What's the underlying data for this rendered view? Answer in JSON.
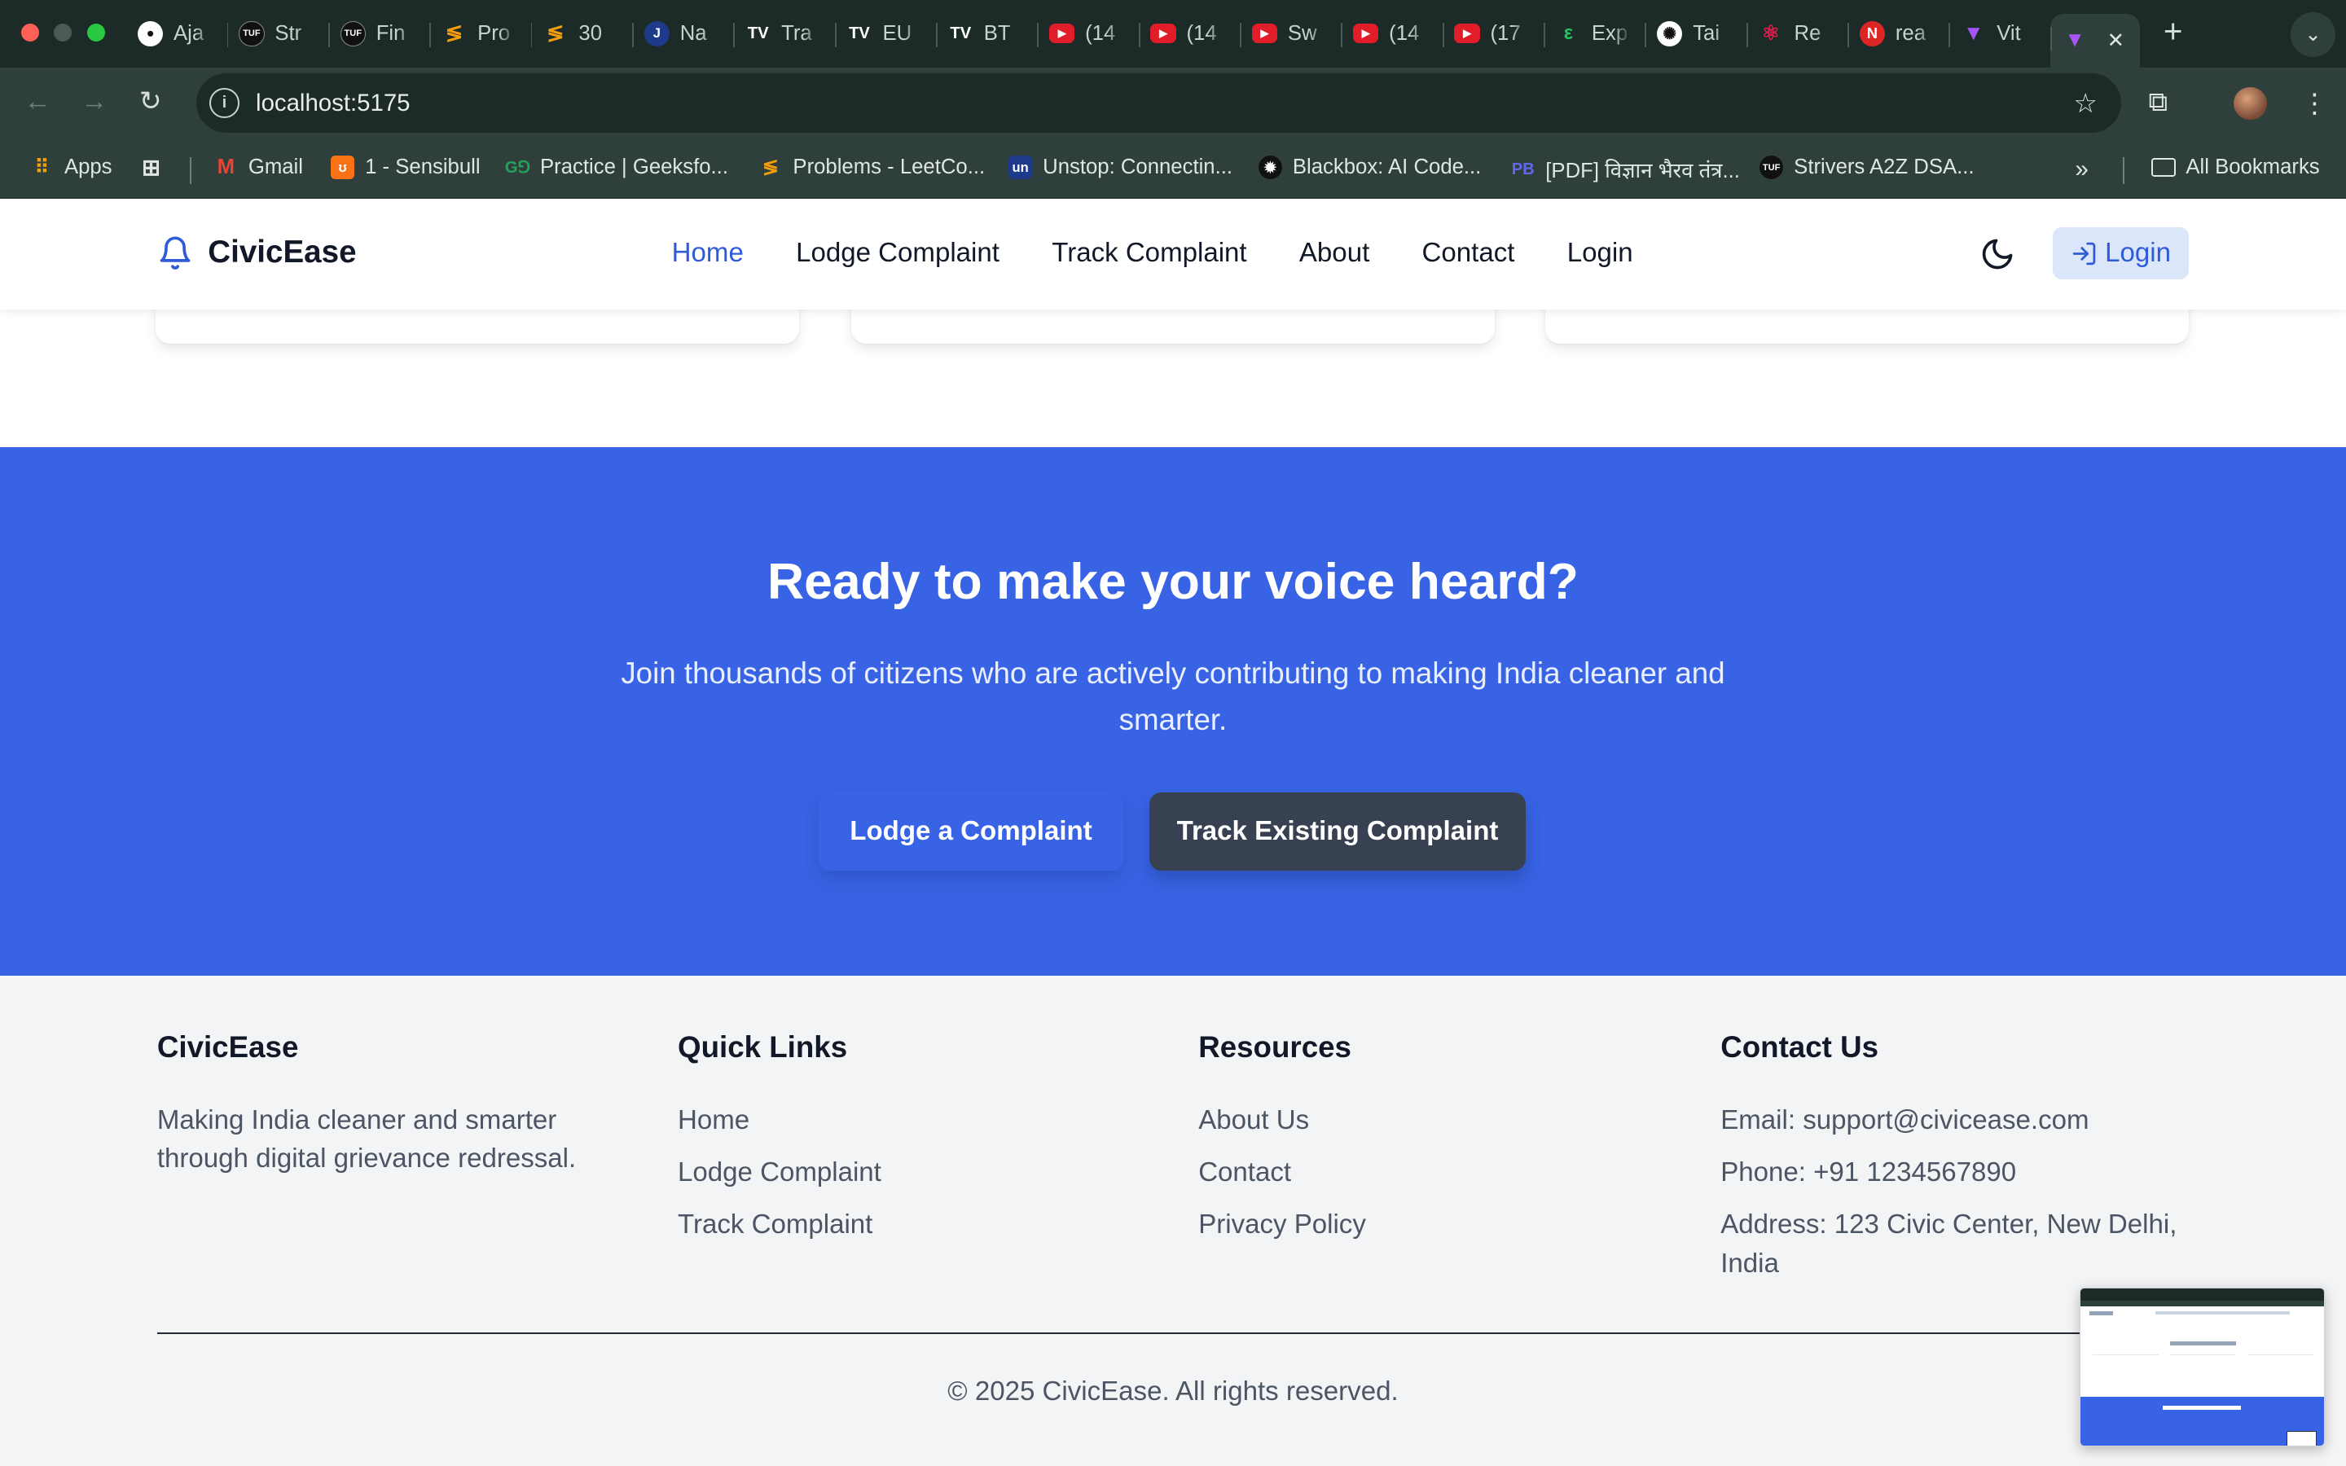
{
  "browser": {
    "tabs": [
      {
        "title": "Aja",
        "icon": "github-icon",
        "color": "#ffffff"
      },
      {
        "title": "Str",
        "icon": "tuf-icon",
        "color": "#111111"
      },
      {
        "title": "Fin",
        "icon": "tuf-icon",
        "color": "#111111"
      },
      {
        "title": "Pro",
        "icon": "codolio-icon",
        "color": "#f59e0b"
      },
      {
        "title": "30",
        "icon": "codolio-icon",
        "color": "#f59e0b"
      },
      {
        "title": "Na",
        "icon": "nav-icon",
        "color": "#1e3a8a"
      },
      {
        "title": "Tra",
        "icon": "tradingview-icon",
        "color": "#111111"
      },
      {
        "title": "EU",
        "icon": "tradingview-icon",
        "color": "#111111"
      },
      {
        "title": "BT",
        "icon": "tradingview-icon",
        "color": "#111111"
      },
      {
        "title": "(14",
        "icon": "youtube-icon",
        "color": "#e11d2a"
      },
      {
        "title": "(14",
        "icon": "youtube-icon",
        "color": "#e11d2a"
      },
      {
        "title": "Sw",
        "icon": "youtube-icon",
        "color": "#e11d2a"
      },
      {
        "title": "(14",
        "icon": "youtube-icon",
        "color": "#e11d2a"
      },
      {
        "title": "(17",
        "icon": "youtube-icon",
        "color": "#e11d2a"
      },
      {
        "title": "Exp",
        "icon": "express-icon",
        "color": "#22c55e"
      },
      {
        "title": "Tai",
        "icon": "openai-icon",
        "color": "#ffffff"
      },
      {
        "title": "Re",
        "icon": "react-icon",
        "color": "#e11d48"
      },
      {
        "title": "rea",
        "icon": "notion-icon",
        "color": "#dc2626"
      },
      {
        "title": "Vit",
        "icon": "vite-icon",
        "color": "#a855f7"
      }
    ],
    "active_tab_icon": "vite-icon",
    "url": "localhost:5175",
    "bookmarks": [
      {
        "label": "Apps",
        "icon": "apps-grid-icon"
      },
      {
        "label": "",
        "icon": "tab-groups-icon"
      },
      {
        "label": "Gmail",
        "icon": "gmail-icon"
      },
      {
        "label": "1 - Sensibull",
        "icon": "sensibull-icon"
      },
      {
        "label": "Practice | Geeksfo...",
        "icon": "geeksforgeeks-icon"
      },
      {
        "label": "Problems - LeetCo...",
        "icon": "leetcode-icon"
      },
      {
        "label": "Unstop: Connectin...",
        "icon": "unstop-icon"
      },
      {
        "label": "Blackbox: AI Code...",
        "icon": "blackbox-icon"
      },
      {
        "label": "[PDF] विज्ञान भैरव तंत्र...",
        "icon": "pdf-icon"
      },
      {
        "label": "Strivers A2Z DSA...",
        "icon": "tuf-icon"
      }
    ],
    "all_bookmarks": "All Bookmarks"
  },
  "site": {
    "brand": "CivicEase",
    "nav": [
      "Home",
      "Lodge Complaint",
      "Track Complaint",
      "About",
      "Contact",
      "Login"
    ],
    "active_nav": "Home",
    "login_button": "Login",
    "accent": "#2f5bd8"
  },
  "cta": {
    "title": "Ready to make your voice heard?",
    "subtitle": "Join thousands of citizens who are actively contributing to making India cleaner and smarter.",
    "primary_button": "Lodge a Complaint",
    "secondary_button": "Track Existing Complaint",
    "background": "#3763e4"
  },
  "footer": {
    "about": {
      "heading": "CivicEase",
      "text": "Making India cleaner and smarter through digital grievance redressal."
    },
    "quick_links": {
      "heading": "Quick Links",
      "items": [
        "Home",
        "Lodge Complaint",
        "Track Complaint"
      ]
    },
    "resources": {
      "heading": "Resources",
      "items": [
        "About Us",
        "Contact",
        "Privacy Policy"
      ]
    },
    "contact": {
      "heading": "Contact Us",
      "items": [
        "Email: support@civicease.com",
        "Phone: +91 1234567890",
        "Address: 123 Civic Center, New Delhi, India"
      ]
    },
    "copyright": "© 2025 CivicEase. All rights reserved."
  }
}
